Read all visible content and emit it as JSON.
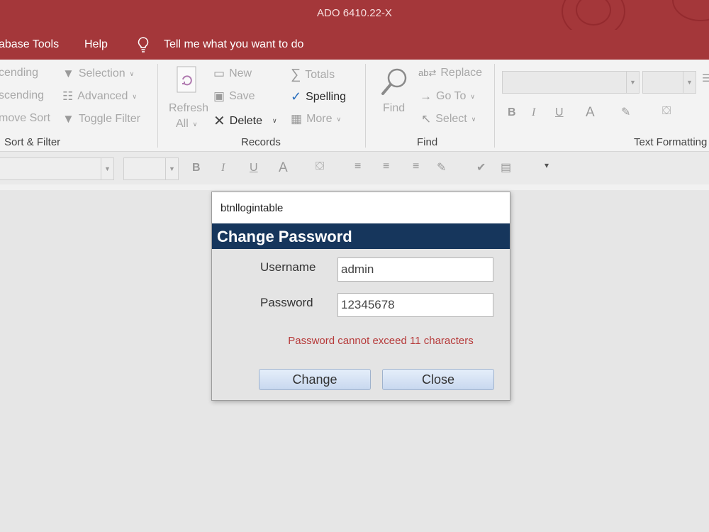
{
  "window": {
    "title": "ADO 6410.22-X"
  },
  "menu": {
    "items": [
      "abase Tools",
      "Help"
    ],
    "tell_me": "Tell me what you want to do"
  },
  "ribbon": {
    "sort_filter": {
      "ascending": "cending",
      "descending": "scending",
      "remove_sort": "move Sort",
      "selection": "Selection",
      "advanced": "Advanced",
      "toggle_filter": "Toggle Filter",
      "label": "Sort & Filter"
    },
    "records": {
      "refresh": "Refresh",
      "refresh_all": "All",
      "new": "New",
      "save": "Save",
      "delete": "Delete",
      "totals": "Totals",
      "spelling": "Spelling",
      "more": "More",
      "label": "Records"
    },
    "find": {
      "find": "Find",
      "replace": "Replace",
      "go_to": "Go To",
      "select": "Select",
      "label": "Find"
    },
    "text_formatting": {
      "label": "Text Formatting",
      "bold": "B",
      "italic": "I",
      "underline": "U",
      "font_color": "A"
    }
  },
  "format_bar": {
    "bold": "B",
    "italic": "I",
    "underline": "U",
    "font_color": "A"
  },
  "dialog": {
    "title": "btnllogintable",
    "header": "Change Password",
    "username_label": "Username",
    "username_value": "admin",
    "password_label": "Password",
    "password_value": "12345678",
    "error": "Password cannot exceed 11 characters",
    "change_button": "Change",
    "close_button": "Close"
  },
  "colors": {
    "title_bar": "#a4373a",
    "dialog_header": "#16365c",
    "error_text": "#b63a3a",
    "workspace": "#e6e6e6"
  }
}
